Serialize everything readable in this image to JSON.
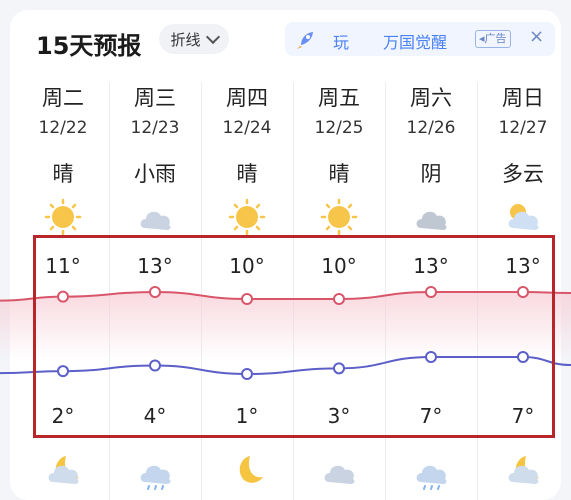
{
  "header": {
    "title": "15天预报",
    "chart_type_label": "折线"
  },
  "ad": {
    "play_text": "玩",
    "brand": "万国觉醒",
    "tag": "广告",
    "close_glyph": "×"
  },
  "days": [
    {
      "weekday": "周二",
      "date": "12/22",
      "condition": "晴",
      "high": "11°",
      "low": "2°",
      "day_icon": "sun-icon",
      "night_icon": "moon-cloud-icon"
    },
    {
      "weekday": "周三",
      "date": "12/23",
      "condition": "小雨",
      "high": "13°",
      "low": "4°",
      "day_icon": "cloud-icon",
      "night_icon": "rain-cloud-icon"
    },
    {
      "weekday": "周四",
      "date": "12/24",
      "condition": "晴",
      "high": "10°",
      "low": "1°",
      "day_icon": "sun-icon",
      "night_icon": "moon-icon"
    },
    {
      "weekday": "周五",
      "date": "12/25",
      "condition": "晴",
      "high": "10°",
      "low": "3°",
      "day_icon": "sun-icon",
      "night_icon": "cloud-icon"
    },
    {
      "weekday": "周六",
      "date": "12/26",
      "condition": "阴",
      "high": "13°",
      "low": "7°",
      "day_icon": "overcast-icon",
      "night_icon": "rain-cloud-icon"
    },
    {
      "weekday": "周日",
      "date": "12/27",
      "condition": "多云",
      "high": "13°",
      "low": "7°",
      "day_icon": "partly-cloudy-icon",
      "night_icon": "moon-cloud-icon"
    }
  ],
  "chart_data": {
    "type": "line",
    "categories": [
      "12/22",
      "12/23",
      "12/24",
      "12/25",
      "12/26",
      "12/27"
    ],
    "series": [
      {
        "values": [
          11,
          13,
          10,
          10,
          13,
          13
        ]
      },
      {
        "values": [
          2,
          4,
          1,
          3,
          7,
          7
        ]
      }
    ],
    "colors": {
      "high": "#d9566a",
      "low": "#5b5fc7"
    }
  },
  "colors": {
    "highlight_border": "#b8262c",
    "ad_text": "#4a82f5"
  }
}
